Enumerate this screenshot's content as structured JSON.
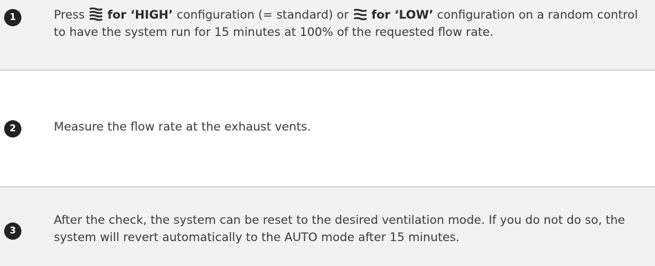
{
  "steps": [
    {
      "number": "1",
      "press": "Press",
      "high_label": "for ‘HIGH’",
      "mid1": "configuration (= standard) or",
      "low_label": "for ‘LOW’",
      "rest": "configuration on a random control to have the system run for 15 minutes at 100% of the requested flow rate.",
      "icons": [
        "ventilation-high-icon",
        "ventilation-low-icon"
      ]
    },
    {
      "number": "2",
      "text": "Measure the flow rate at the exhaust vents."
    },
    {
      "number": "3",
      "text": "After the check, the system can be reset to the desired ventilation mode. If you do not do so, the system will revert automatically to the AUTO mode after 15 minutes."
    }
  ],
  "colors": {
    "shaded_row": "#f2f2f2",
    "badge": "#222222",
    "text": "#3a3a3a",
    "divider": "#b9b9b9"
  }
}
